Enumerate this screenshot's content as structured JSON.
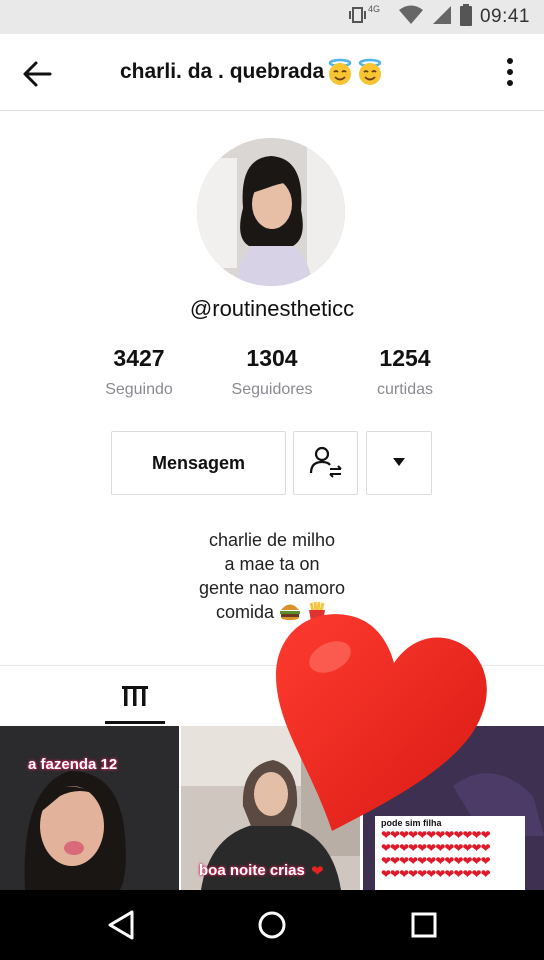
{
  "status_bar": {
    "time": "09:41",
    "network_label": "4G",
    "icons": [
      "vibrate-icon",
      "wifi-icon",
      "signal-icon",
      "battery-icon"
    ]
  },
  "header": {
    "title": "charli. da . quebrada",
    "title_emojis": [
      "smiling-face-with-halo",
      "smiling-face-with-halo"
    ]
  },
  "profile": {
    "handle": "@routinestheticc",
    "stats": [
      {
        "value": "3427",
        "label": "Seguindo"
      },
      {
        "value": "1304",
        "label": "Seguidores"
      },
      {
        "value": "1254",
        "label": "curtidas"
      }
    ],
    "message_button": "Mensagem",
    "bio": [
      "charlie de milho",
      "a mae ta on",
      "gente nao namoro",
      "comida"
    ],
    "bio_emojis": [
      "hamburger",
      "fries"
    ]
  },
  "tabs": {
    "active": "videos-grid"
  },
  "videos": [
    {
      "caption": "a fazenda 12"
    },
    {
      "caption": "boa noite crias"
    },
    {
      "caption": "pode sim filha"
    }
  ],
  "overlay": {
    "icon": "heart-icon",
    "color": "#e8231f"
  },
  "colors": {
    "status_bar_bg": "#e9e9e9",
    "text_primary": "#161823",
    "text_secondary": "#8a8b91",
    "nav_bar_bg": "#000000"
  }
}
